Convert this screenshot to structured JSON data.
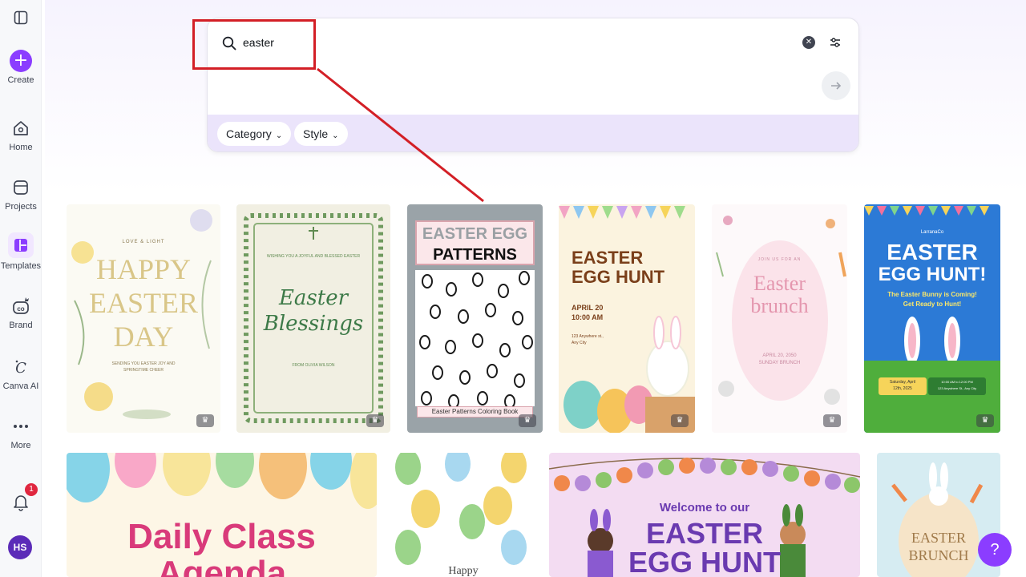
{
  "sidebar": {
    "items": [
      {
        "label": "Create"
      },
      {
        "label": "Home"
      },
      {
        "label": "Projects"
      },
      {
        "label": "Templates"
      },
      {
        "label": "Brand"
      },
      {
        "label": "Canva AI"
      },
      {
        "label": "More"
      }
    ],
    "notification_count": "1",
    "avatar_initials": "HS"
  },
  "search": {
    "value": "easter",
    "filters": [
      {
        "label": "Category"
      },
      {
        "label": "Style"
      }
    ]
  },
  "templates": [
    {
      "lines": [
        "LOVE & LIGHT",
        "HAPPY",
        "EASTER",
        "DAY",
        "SENDING YOU EASTER JOY AND",
        "SPRINGTIME CHEER"
      ],
      "premium": true
    },
    {
      "lines": [
        "WISHING YOU A JOYFUL AND BLESSED EASTER",
        "Easter",
        "Blessings",
        "FROM OLIVIA WILSON"
      ],
      "premium": true
    },
    {
      "lines": [
        "EASTER EGG",
        "PATTERNS",
        "Easter Patterns Coloring Book"
      ],
      "premium": true
    },
    {
      "lines": [
        "EASTER",
        "EGG HUNT",
        "APRIL 20",
        "10:00 AM",
        "123 Anywhere st.,",
        "Any City"
      ],
      "premium": true
    },
    {
      "lines": [
        "JOIN US FOR AN",
        "Easter",
        "brunch",
        "APRIL 20, 2050",
        "SUNDAY BRUNCH"
      ],
      "premium": true
    },
    {
      "lines": [
        "LarranaCo",
        "EASTER",
        "EGG HUNT!",
        "The Easter Bunny is Coming!",
        "Get Ready to Hunt!",
        "Saturday, April",
        "12th, 2025",
        "10:00 AM to 12:00 PM",
        "123 Anywhere St., Any City"
      ],
      "premium": true
    },
    {
      "lines": [
        "Daily Class",
        "Agenda"
      ],
      "premium": false
    },
    {
      "lines": [
        "Happy"
      ],
      "premium": false
    },
    {
      "lines": [
        "Welcome to our",
        "EASTER",
        "EGG HUNT"
      ],
      "premium": false
    },
    {
      "lines": [
        "EASTER",
        "BRUNCH"
      ],
      "premium": false
    }
  ],
  "help_label": "?",
  "colors": {
    "accent": "#8b3dff",
    "highlight": "#d31f26",
    "filter_bar": "#ebe4fb"
  }
}
